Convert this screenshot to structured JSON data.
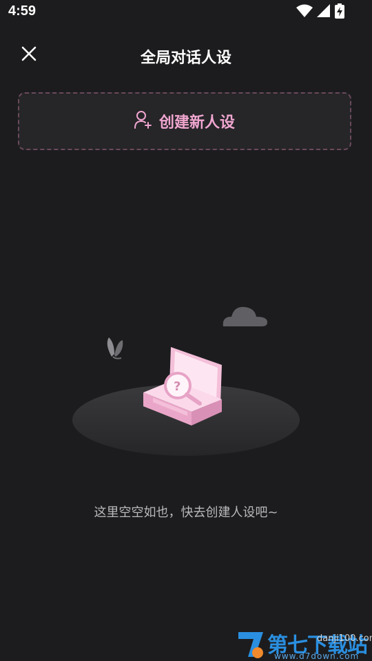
{
  "status_bar": {
    "time": "4:59"
  },
  "header": {
    "title": "全局对话人设",
    "close_icon": "close-icon"
  },
  "create_button": {
    "label": "创建新人设",
    "icon": "add-user-icon"
  },
  "empty_state": {
    "message": "这里空空如也，快去创建人设吧~",
    "illustration": "empty-box-magnifier-illustration"
  },
  "watermark": {
    "title": "第七下载站",
    "url": "danji100.com",
    "domain": "www.d7down.com"
  },
  "colors": {
    "background": "#1c1c1e",
    "accent_pink": "#f0a6d0",
    "dashed_border": "#6a4a5c",
    "secondary_text": "#b9b9bc"
  }
}
